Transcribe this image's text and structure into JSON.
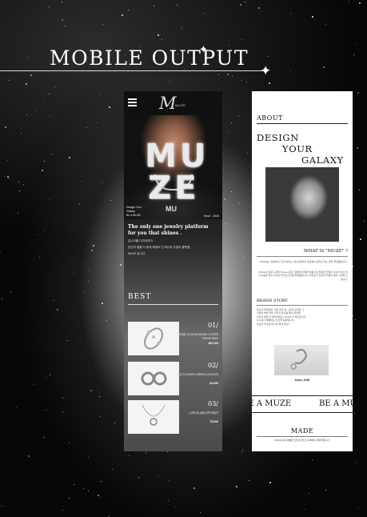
{
  "headline": "MOBILE OUTPUT",
  "left_phone": {
    "brand": "MUZE",
    "hero_word_top": "MU",
    "hero_word_bottom": "ZE",
    "hero_small": "MU",
    "hero_side_lines": [
      "Design Your",
      "Galaxy",
      "Be a MUZE"
    ],
    "hero_since": "Since . 2026",
    "intro_title_1": "The only one jewelry platform",
    "intro_title_2": "for you that shines .",
    "intro_kr_1": "유니크를 디자인하다.",
    "intro_kr_2": "당신의 별을 더 밝게 해줘요 단 하나의 주얼리 플랫폼,",
    "intro_kr_3": "MUZE 입니다.",
    "best_title": "BEST",
    "products": [
      {
        "num": "01/",
        "name": "[오리지널] VN MONOGRAM CLOVER TENNIS RING",
        "price": "482,000"
      },
      {
        "num": "02/",
        "name": "[메르디] POLISHED ARRING (SILVER)",
        "price": "63,000"
      },
      {
        "num": "03/",
        "name": "[ 큐빅/자] 글래 큐빅 목걸이",
        "price": "79,000"
      }
    ]
  },
  "right_phone": {
    "about": "ABOUT",
    "design_1": "DESIGN",
    "design_2": "YOUR",
    "design_3": "GALAXY",
    "what_is": "WHAT IS \"MUZE\" ?",
    "para_1": "'MUZE'는 '세상에서 가장 빛나는 나를 표현하여 위로를이 흘러드리는 선물' 플랫폼입니다.",
    "para_2": "'MUZE'의 뜻은 구체적 'Muse'(뮤즈) 영예적 주얼리 마음으로 펼쳐진 주얼리 다이아 하나 하나 마음을 담아 이어진 라이프스타일 플랫폼입니다. 무엇보다 진정한 주얼리 제작 기업을 드립니다.",
    "brand_story": "BRAND STORY",
    "story_lines": [
      "당신의 매력처럼, 어떤 우주 속 그곳의 공감을 그\"",
      "나만의 빛을 찾아 자신의 뮤즈를 별이 되어줄",
      "당신의 빛을 더 밝게 해주는 'MUZE'가 해드립니다.",
      "누구보다 특별하는 당신을 응원합니다.",
      "당신의 우주를 빛나게 해 볼까요?"
    ],
    "since": "since, 2026",
    "marquee": "BE A MUZE",
    "made": "MADE",
    "made_desc": "MUZE 단의 특별한 당신이 얻고 지쳐해야 주얼리입니다."
  }
}
